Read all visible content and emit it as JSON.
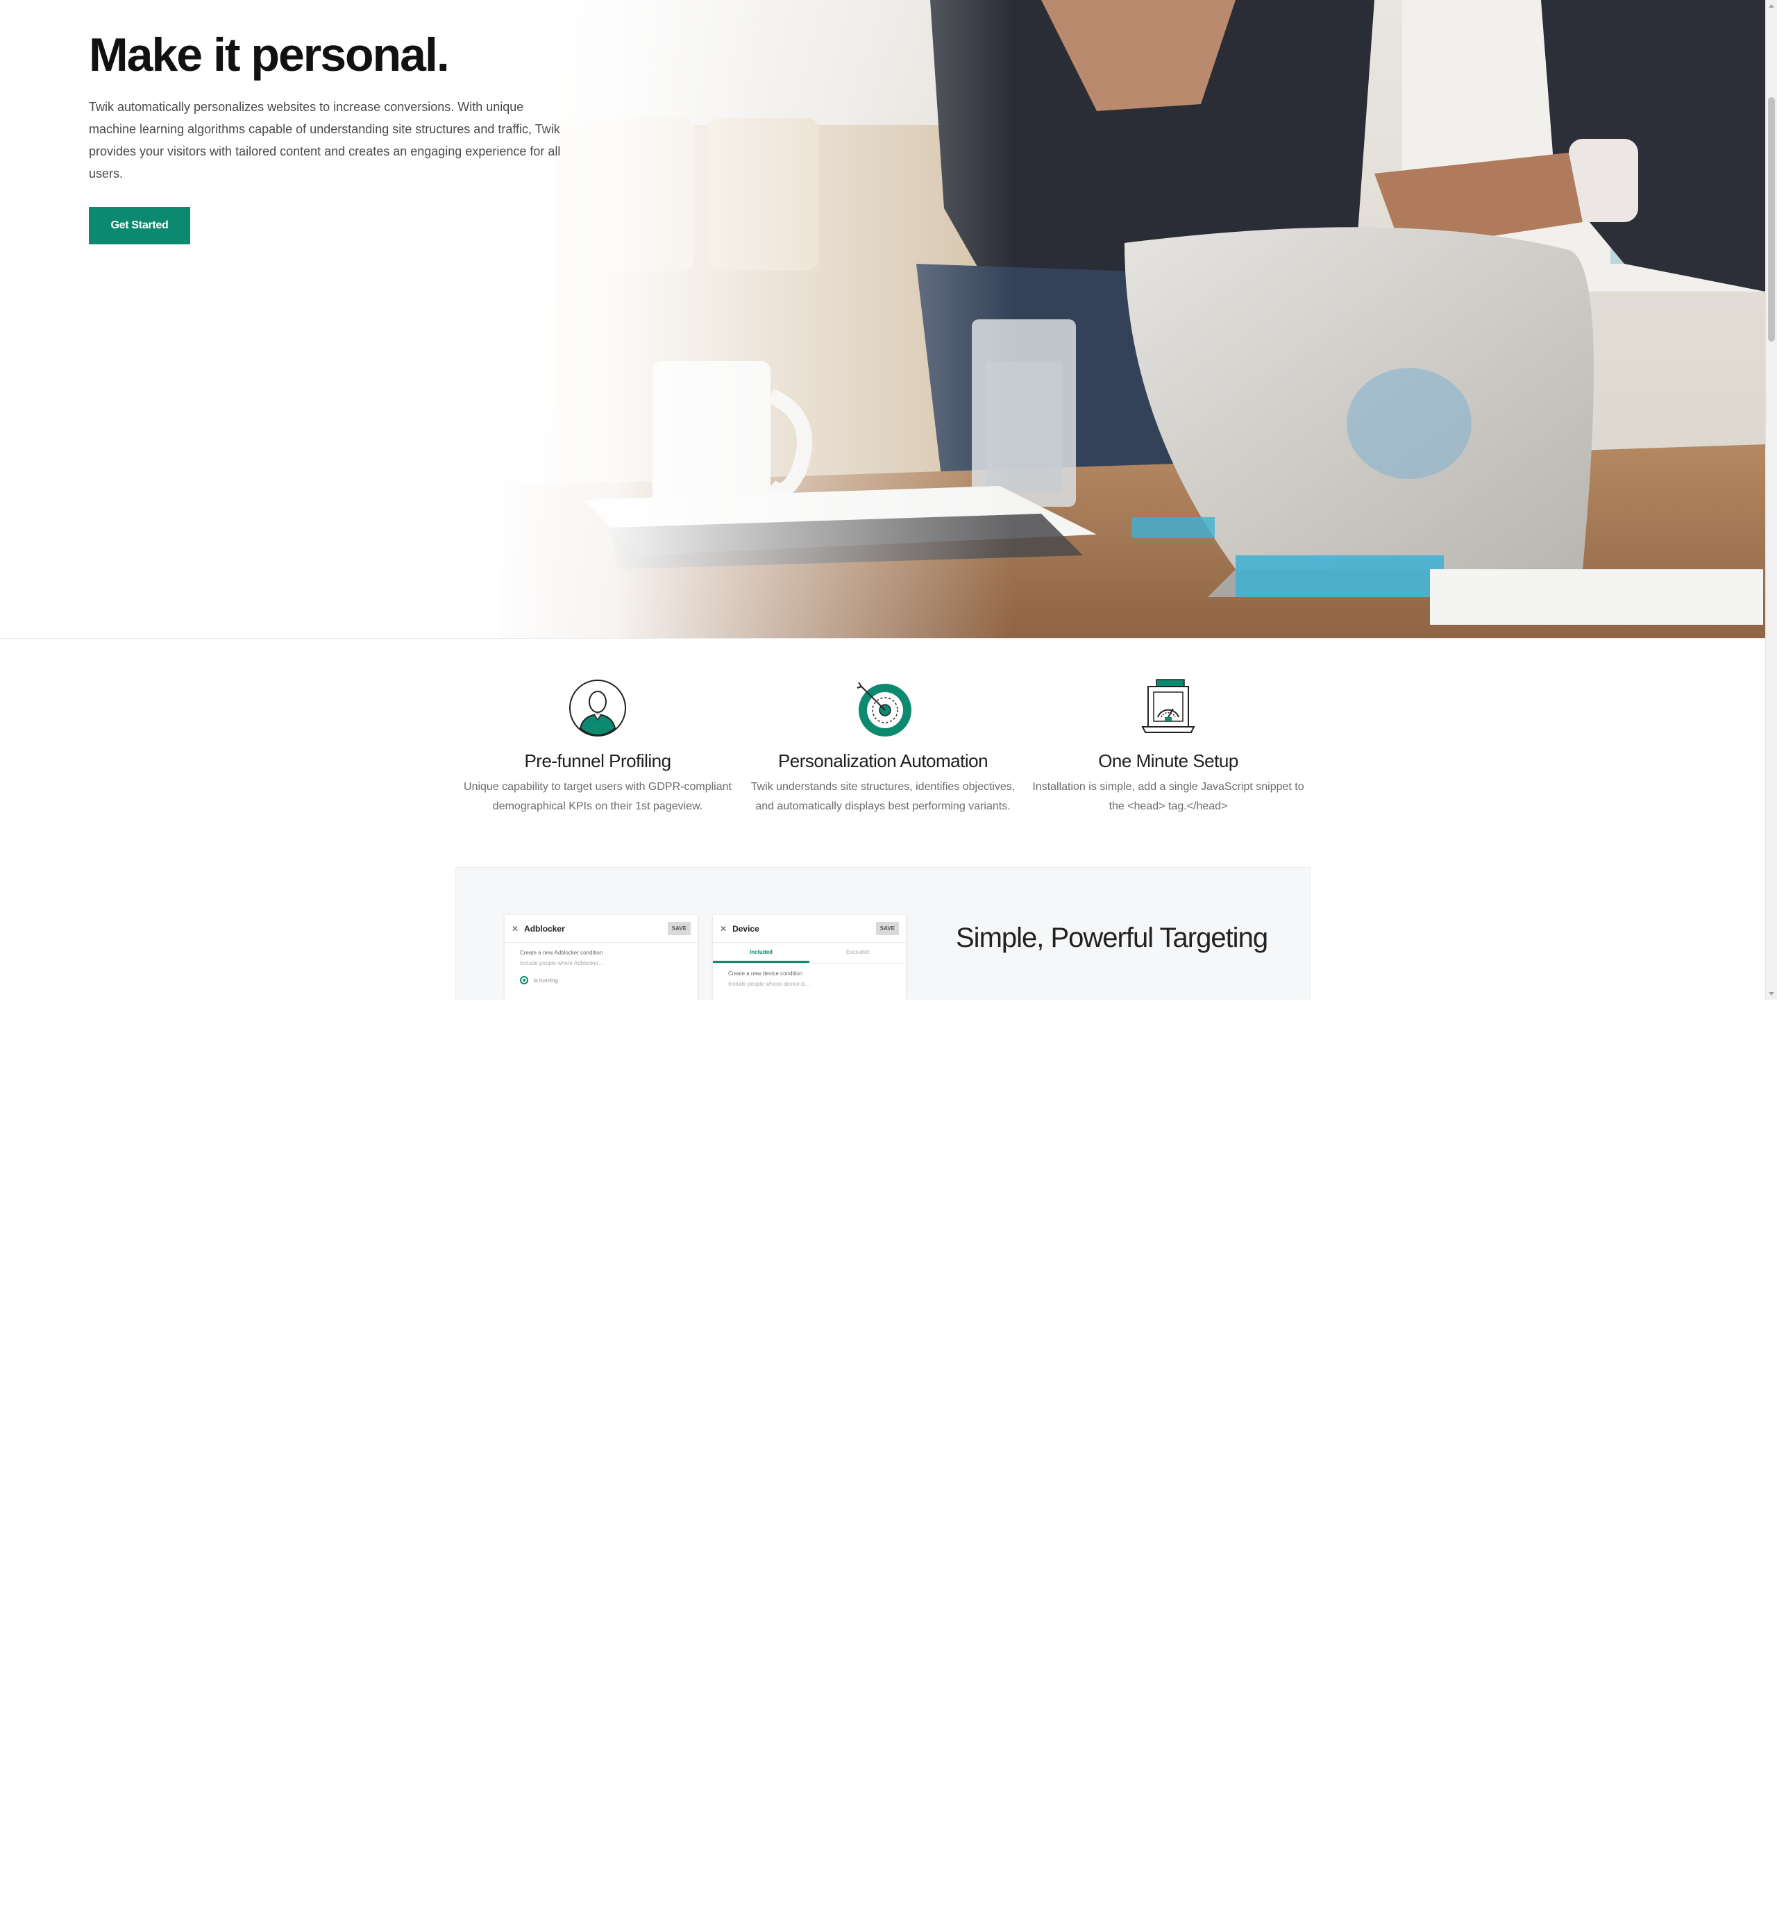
{
  "hero": {
    "title": "Make it personal.",
    "description": "Twik automatically personalizes websites to increase conversions. With unique machine learning algorithms capable of understanding site structures and traffic, Twik provides your visitors with tailored content and creates an engaging experience for all users.",
    "cta_label": "Get Started",
    "image": "workspace-laptop-photo"
  },
  "features": [
    {
      "icon": "user-profile-icon",
      "title": "Pre-funnel Profiling",
      "description": "Unique capability to target users with GDPR-compliant demographical KPIs on their 1st pageview."
    },
    {
      "icon": "target-icon",
      "title": "Personalization Automation",
      "description": "Twik understands site structures, identifies objectives, and automatically displays best performing variants."
    },
    {
      "icon": "laptop-gauge-icon",
      "title": "One Minute Setup",
      "description": "Installation is simple, add a single JavaScript snippet to the <head> tag.</head>"
    }
  ],
  "targeting": {
    "title": "Simple, Powerful Targeting",
    "panels": [
      {
        "title": "Adblocker",
        "save": "SAVE",
        "heading": "Create a new Adblocker condition",
        "sub": "Include people where Adblocker...",
        "option": "is running"
      },
      {
        "title": "Device",
        "save": "SAVE",
        "tabs": [
          "Included",
          "Excluded"
        ],
        "heading": "Create a new device condition",
        "sub": "Include people whose device is..."
      }
    ]
  },
  "colors": {
    "brand": "#0b8a6f",
    "text": "#1a1a1a",
    "muted": "#6b6b6b"
  }
}
